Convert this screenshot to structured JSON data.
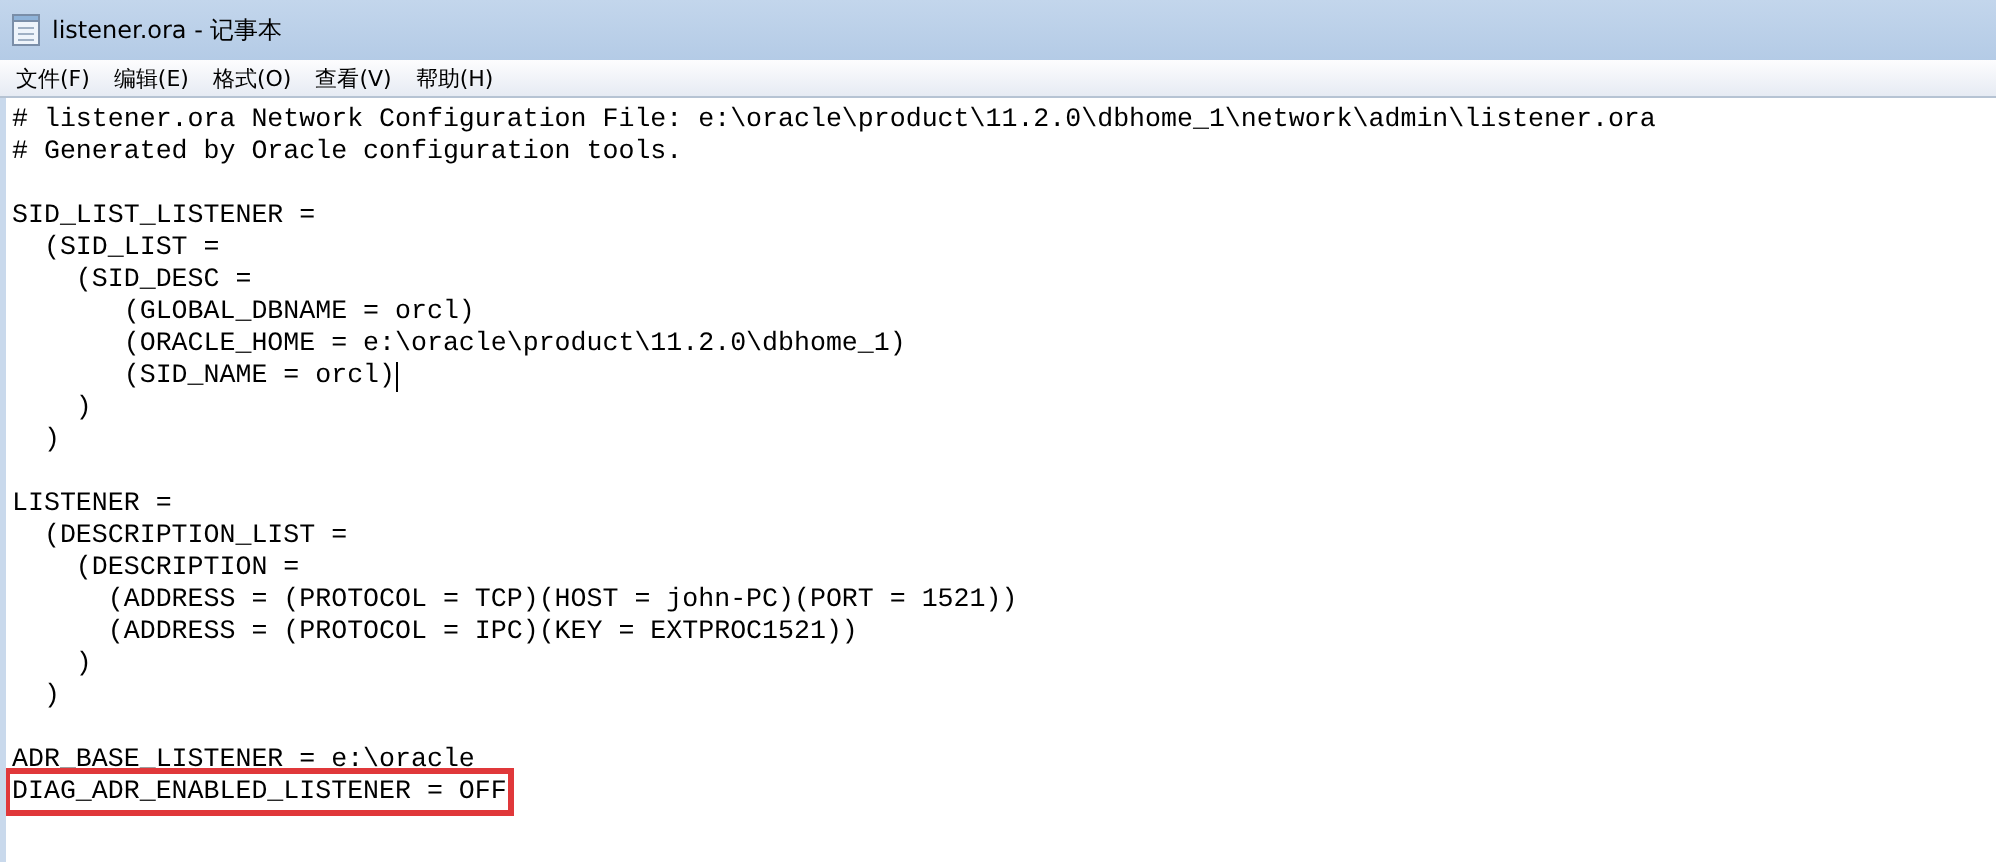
{
  "window": {
    "title": "listener.ora - 记事本"
  },
  "menu": [
    {
      "label": "文件(F)"
    },
    {
      "label": "编辑(E)"
    },
    {
      "label": "格式(O)"
    },
    {
      "label": "查看(V)"
    },
    {
      "label": "帮助(H)"
    }
  ],
  "editor": {
    "lines": [
      {
        "text": "# listener.ora Network Configuration File: e:\\oracle\\product\\11.2.0\\dbhome_1\\network\\admin\\listener.ora",
        "highlighted": false,
        "caret": false
      },
      {
        "text": "# Generated by Oracle configuration tools.",
        "highlighted": false,
        "caret": false
      },
      {
        "highlighted": false,
        "caret": false
      },
      {
        "text": "SID_LIST_LISTENER =",
        "highlighted": false,
        "caret": false
      },
      {
        "text": "  (SID_LIST =",
        "highlighted": false,
        "caret": false
      },
      {
        "text": "    (SID_DESC =",
        "highlighted": false,
        "caret": false
      },
      {
        "text": "       (GLOBAL_DBNAME = orcl)",
        "highlighted": false,
        "caret": false
      },
      {
        "text": "       (ORACLE_HOME = e:\\oracle\\product\\11.2.0\\dbhome_1)",
        "highlighted": false,
        "caret": false
      },
      {
        "text": "       (SID_NAME = orcl)",
        "highlighted": false,
        "caret": true
      },
      {
        "text": "    )",
        "highlighted": false,
        "caret": false
      },
      {
        "text": "  )",
        "highlighted": false,
        "caret": false
      },
      {
        "highlighted": false,
        "caret": false
      },
      {
        "text": "LISTENER =",
        "highlighted": false,
        "caret": false
      },
      {
        "text": "  (DESCRIPTION_LIST =",
        "highlighted": false,
        "caret": false
      },
      {
        "text": "    (DESCRIPTION =",
        "highlighted": false,
        "caret": false
      },
      {
        "text": "      (ADDRESS = (PROTOCOL = TCP)(HOST = john-PC)(PORT = 1521))",
        "highlighted": false,
        "caret": false
      },
      {
        "text": "      (ADDRESS = (PROTOCOL = IPC)(KEY = EXTPROC1521))",
        "highlighted": false,
        "caret": false
      },
      {
        "text": "    )",
        "highlighted": false,
        "caret": false
      },
      {
        "text": "  )",
        "highlighted": false,
        "caret": false
      },
      {
        "highlighted": false,
        "caret": false
      },
      {
        "text": "ADR_BASE_LISTENER = e:\\oracle",
        "highlighted": false,
        "caret": false
      },
      {
        "text": "DIAG_ADR_ENABLED_LISTENER = OFF",
        "highlighted": true,
        "caret": false
      }
    ]
  }
}
